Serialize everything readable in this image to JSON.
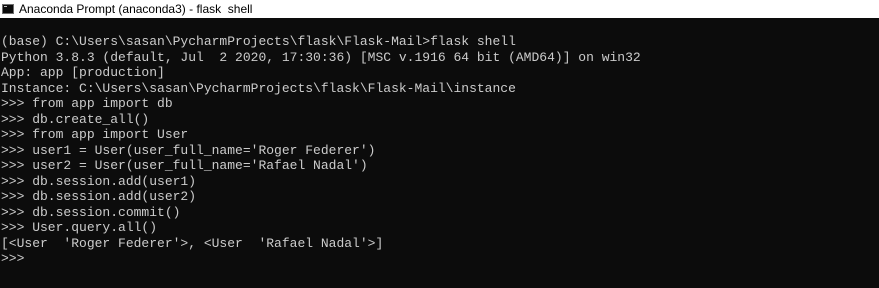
{
  "window": {
    "title": "Anaconda Prompt (anaconda3) - flask  shell",
    "icon": "terminal-icon"
  },
  "console": {
    "lines": [
      "(base) C:\\Users\\sasan\\PycharmProjects\\flask\\Flask-Mail>flask shell",
      "Python 3.8.3 (default, Jul  2 2020, 17:30:36) [MSC v.1916 64 bit (AMD64)] on win32",
      "App: app [production]",
      "Instance: C:\\Users\\sasan\\PycharmProjects\\flask\\Flask-Mail\\instance",
      ">>> from app import db",
      ">>> db.create_all()",
      ">>> from app import User",
      ">>> user1 = User(user_full_name='Roger Federer')",
      ">>> user2 = User(user_full_name='Rafael Nadal')",
      ">>> db.session.add(user1)",
      ">>> db.session.add(user2)",
      ">>> db.session.commit()",
      ">>> User.query.all()",
      "[<User  'Roger Federer'>, <User  'Rafael Nadal'>]",
      ">>>"
    ]
  },
  "colors": {
    "background": "#0c0c0c",
    "text": "#cccccc",
    "titlebar": "#ffffff"
  }
}
